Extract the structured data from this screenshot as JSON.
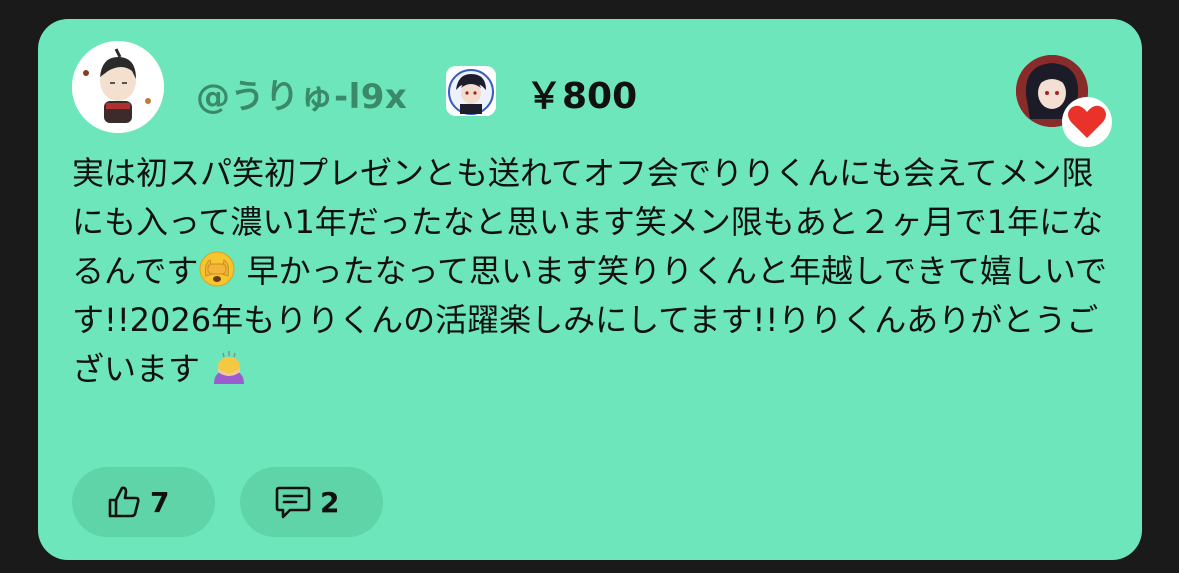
{
  "post": {
    "username": "@うりゅ-l9x",
    "amount": "￥800",
    "message_parts": {
      "p1": "実は初スパ笑初プレゼンとも送れてオフ会でりりくんにも会えてメン限にも入って濃い1年だったなと思います笑メン限もあと２ヶ月で1年になるんです",
      "p2": "早かったなって思います笑りりくんと年越しできて嬉しいです!!2026年もりりくんの活躍楽しみにしてます!!りりくんありがとうございます"
    },
    "emojis": [
      "face-peeking-icon",
      "person-bowing-icon"
    ],
    "likes": "7",
    "comments": "2"
  },
  "colors": {
    "card_bg": "#6ee6bb",
    "pill_bg": "#5fd4a9",
    "username": "#3a8a6a",
    "heart": "#e8322a"
  }
}
